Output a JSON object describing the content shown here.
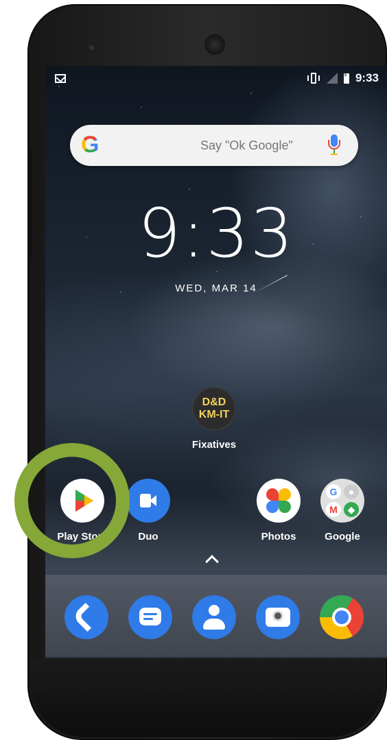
{
  "status_bar": {
    "time": "9:33",
    "left_icon": "gmail-notification-icon",
    "right_icons": [
      "vibrate-icon",
      "signal-icon",
      "battery-charging-icon"
    ]
  },
  "search": {
    "placeholder": "Say \"Ok Google\"",
    "logo_letter": "G",
    "mic_icon": "mic-icon"
  },
  "clock": {
    "time": "9:33",
    "date": "WED, MAR 14"
  },
  "folder": {
    "badge_line1": "D&D",
    "badge_line2": "KM-IT",
    "label": "Fixatives"
  },
  "apps": [
    {
      "label": "Play Store",
      "icon": "play-store-icon"
    },
    {
      "label": "Duo",
      "icon": "duo-icon"
    },
    {
      "label": "Photos",
      "icon": "photos-icon"
    },
    {
      "label": "Google",
      "icon": "google-folder-icon"
    }
  ],
  "dock": [
    {
      "name": "phone",
      "icon": "phone-icon"
    },
    {
      "name": "messages",
      "icon": "messages-icon"
    },
    {
      "name": "contacts",
      "icon": "contacts-icon"
    },
    {
      "name": "camera",
      "icon": "camera-icon"
    },
    {
      "name": "chrome",
      "icon": "chrome-icon"
    }
  ],
  "colors": {
    "highlight_ring": "#86a838",
    "app_blue": "#2f7be8",
    "folder_text": "#f4d25a"
  }
}
